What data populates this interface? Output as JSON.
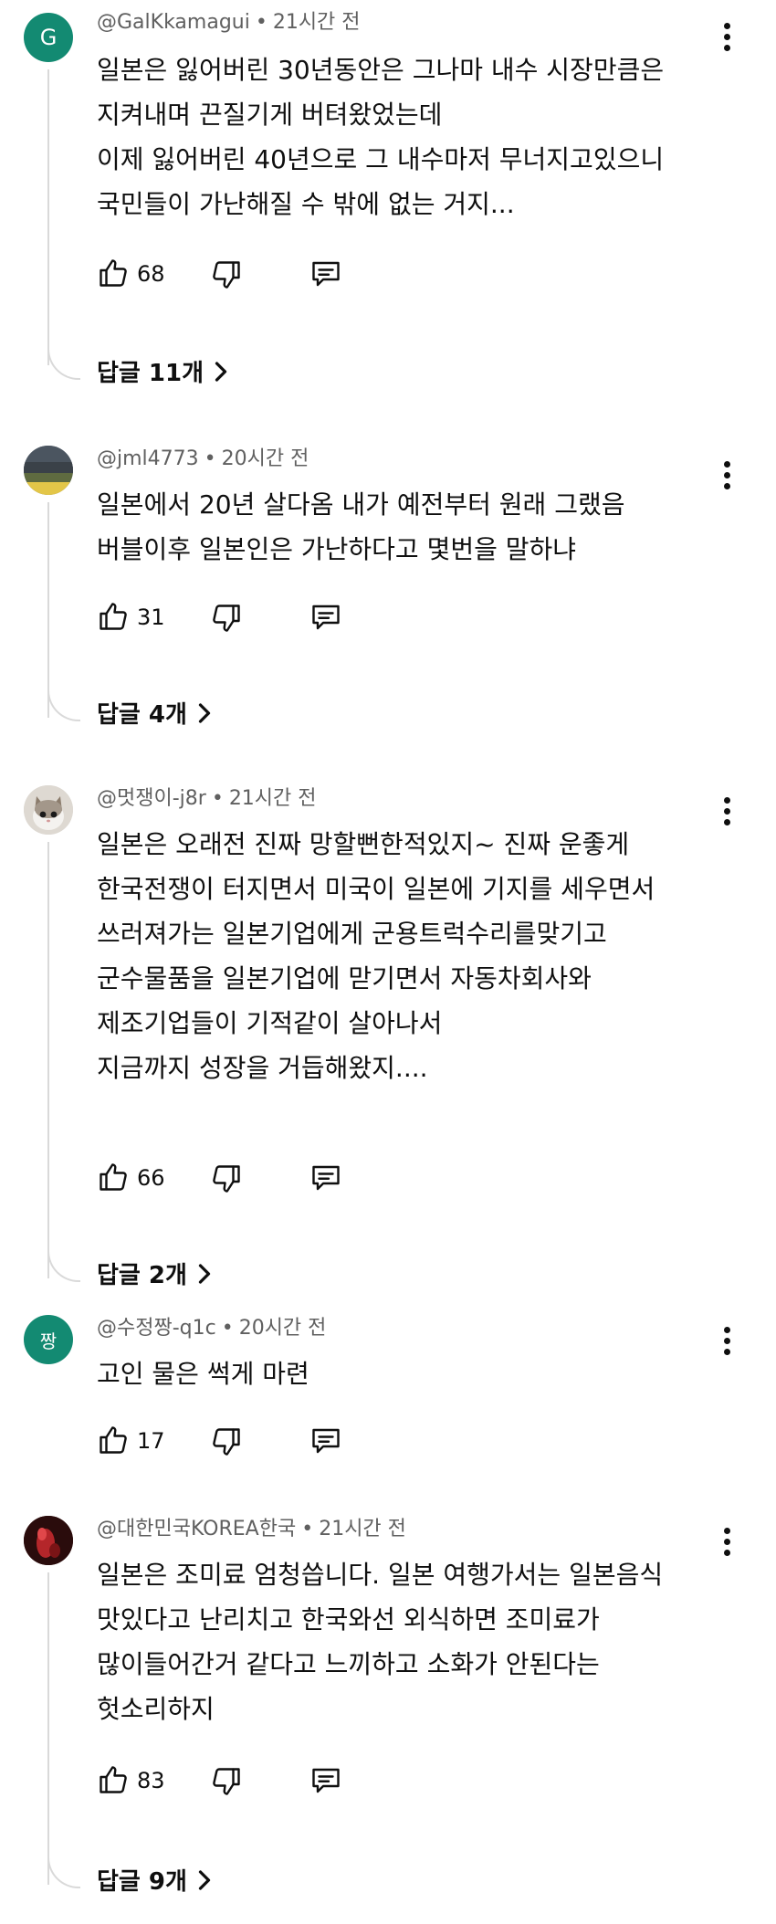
{
  "comments": [
    {
      "avatar_letter": "G",
      "avatar_color": "#138a72",
      "author": "@GalKkamagui",
      "time": "21시간 전",
      "lines": [
        "일본은 잃어버린 30년동안은 그나마 내수 시장만큼은",
        "지켜내며 끈질기게 버텨왔었는데",
        "이제 잃어버린 40년으로 그 내수마저 무너지고있으니",
        "국민들이 가난해질 수 밖에 없는 거지..."
      ],
      "likes": "68",
      "replies": "답글 11개"
    },
    {
      "avatar_letter": "",
      "avatar_color": "#6b7a86",
      "author": "@jml4773",
      "time": "20시간 전",
      "lines": [
        "일본에서 20년 살다옴 내가 예전부터 원래 그랬음",
        "버블이후 일본인은 가난하다고 몇번을 말하냐"
      ],
      "likes": "31",
      "replies": "답글 4개"
    },
    {
      "avatar_letter": "",
      "avatar_color": "#d9d6d0",
      "author": "@멋쟁이-j8r",
      "time": "21시간 전",
      "lines": [
        "일본은 오래전 진짜 망할뻔한적있지~ 진짜 운좋게",
        "한국전쟁이 터지면서 미국이 일본에 기지를 세우면서",
        "쓰러져가는 일본기업에게 군용트럭수리를맞기고",
        "군수물품을 일본기업에 맏기면서 자동차회사와",
        "제조기업들이 기적같이 살아나서",
        "지금까지 성장을 거듭해왔지...."
      ],
      "likes": "66",
      "replies": "답글 2개"
    },
    {
      "avatar_letter": "짱",
      "avatar_color": "#138a72",
      "author": "@수정짱-q1c",
      "time": "20시간 전",
      "lines": [
        "고인 물은 썩게 마련"
      ],
      "likes": "17",
      "replies": ""
    },
    {
      "avatar_letter": "",
      "avatar_color": "#3a1010",
      "author": "@대한민국KOREA한국",
      "time": "21시간 전",
      "lines": [
        "일본은 조미료 엄청씁니다. 일본 여행가서는 일본음식",
        "맛있다고 난리치고  한국와선  외식하면 조미료가",
        "많이들어간거 같다고 느끼하고 소화가 안된다는",
        "헛소리하지"
      ],
      "likes": "83",
      "replies": "답글 9개"
    }
  ]
}
